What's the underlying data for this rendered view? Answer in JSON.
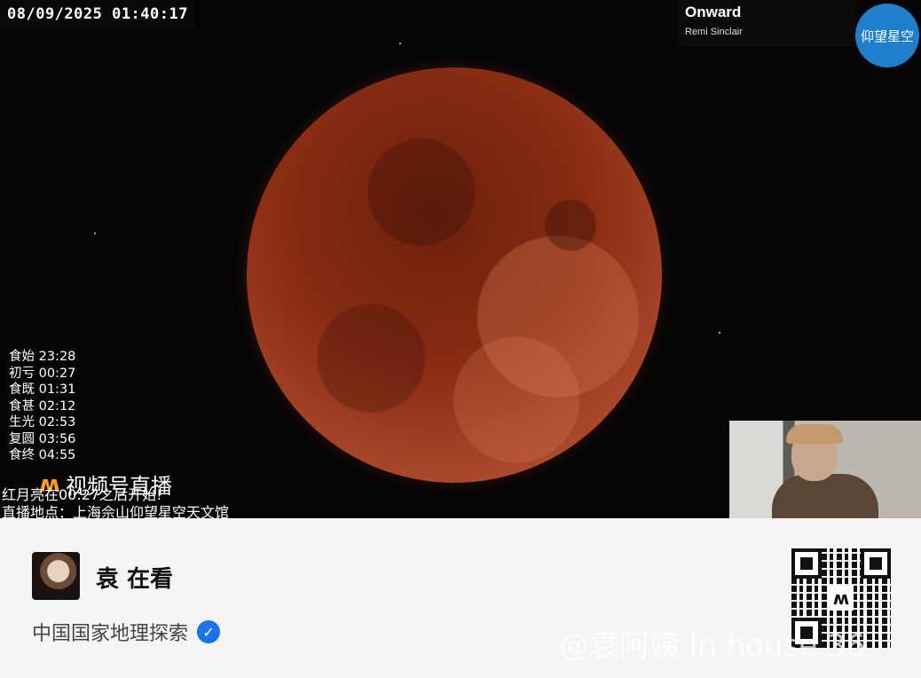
{
  "overlay": {
    "timestamp": "08/09/2025 01:40:17",
    "music_title": "Onward",
    "music_artist": "Remi Sinclair",
    "observatory_logo_text": "仰望星空"
  },
  "eclipse_phases": [
    {
      "label": "食始",
      "time": "23:28"
    },
    {
      "label": "初亏",
      "time": "00:27"
    },
    {
      "label": "食既",
      "time": "01:31"
    },
    {
      "label": "食甚",
      "time": "02:12"
    },
    {
      "label": "生光",
      "time": "02:53"
    },
    {
      "label": "复圆",
      "time": "03:56"
    },
    {
      "label": "食终",
      "time": "04:55"
    }
  ],
  "live": {
    "badge_text": "视频号直播",
    "line1": "红月亮在00:27之后开始!",
    "line2": "直播地点：上海佘山仰望星空天文馆"
  },
  "panel": {
    "viewer_text": "袁 在看",
    "channel_name": "中国国家地理探索",
    "qr_center_glyph": "ʍ"
  },
  "watermark": "@袁阿姨 in house 36",
  "colors": {
    "moon": "#8a2d13",
    "panel_bg": "#f5f5f5",
    "badge_orange": "#ff9a1e",
    "verified_blue": "#1a73e8",
    "logo_blue": "#1e7fcf"
  }
}
